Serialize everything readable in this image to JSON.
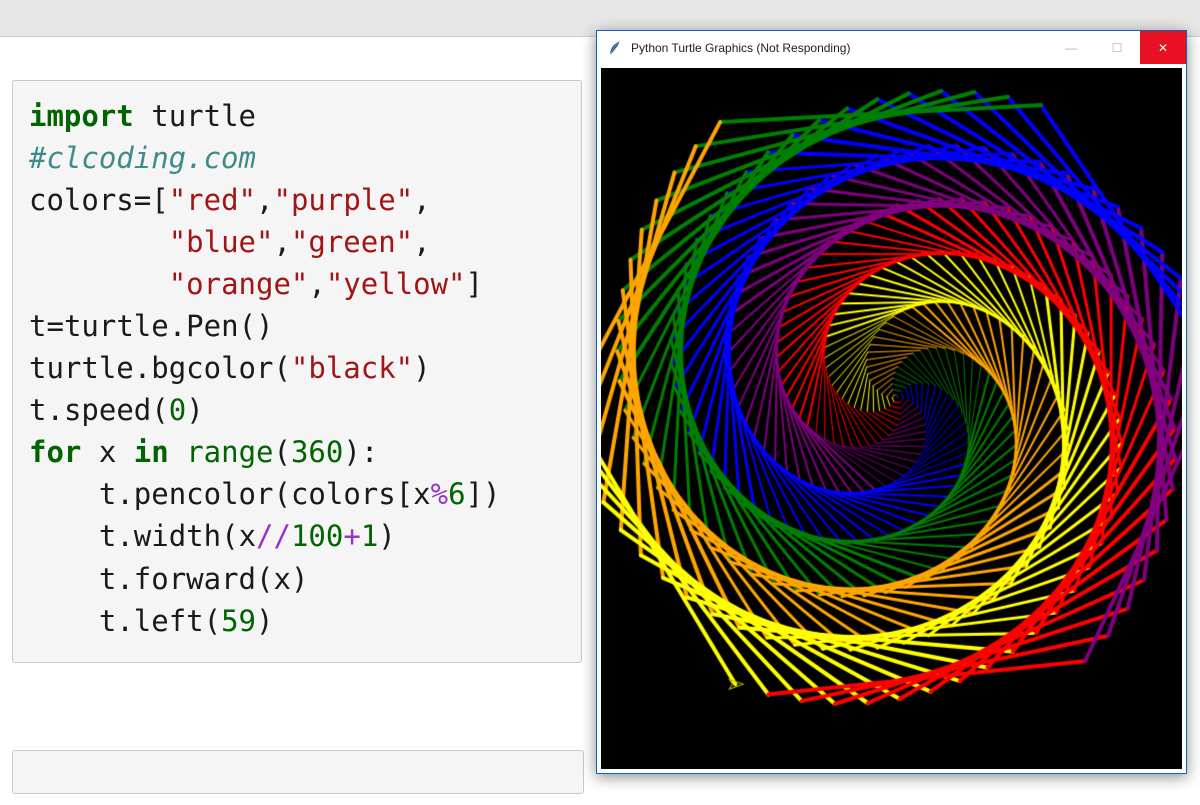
{
  "colors": [
    "red",
    "purple",
    "blue",
    "green",
    "orange",
    "yellow"
  ],
  "codeTokens": [
    [
      {
        "t": "import",
        "c": "kw"
      },
      {
        "t": " ",
        "c": "ident"
      },
      {
        "t": "turtle",
        "c": "ident"
      }
    ],
    [
      {
        "t": "#clcoding.com",
        "c": "cm"
      }
    ],
    [
      {
        "t": "colors",
        "c": "ident"
      },
      {
        "t": "=",
        "c": "punct"
      },
      {
        "t": "[",
        "c": "punct"
      },
      {
        "t": "\"red\"",
        "c": "str"
      },
      {
        "t": ",",
        "c": "punct"
      },
      {
        "t": "\"purple\"",
        "c": "str"
      },
      {
        "t": ",",
        "c": "punct"
      }
    ],
    [
      {
        "t": "        ",
        "c": "ident"
      },
      {
        "t": "\"blue\"",
        "c": "str"
      },
      {
        "t": ",",
        "c": "punct"
      },
      {
        "t": "\"green\"",
        "c": "str"
      },
      {
        "t": ",",
        "c": "punct"
      }
    ],
    [
      {
        "t": "        ",
        "c": "ident"
      },
      {
        "t": "\"orange\"",
        "c": "str"
      },
      {
        "t": ",",
        "c": "punct"
      },
      {
        "t": "\"yellow\"",
        "c": "str"
      },
      {
        "t": "]",
        "c": "punct"
      }
    ],
    [
      {
        "t": "t",
        "c": "ident"
      },
      {
        "t": "=",
        "c": "punct"
      },
      {
        "t": "turtle",
        "c": "ident"
      },
      {
        "t": ".",
        "c": "punct"
      },
      {
        "t": "Pen",
        "c": "ident"
      },
      {
        "t": "()",
        "c": "punct"
      }
    ],
    [
      {
        "t": "turtle",
        "c": "ident"
      },
      {
        "t": ".",
        "c": "punct"
      },
      {
        "t": "bgcolor",
        "c": "ident"
      },
      {
        "t": "(",
        "c": "punct"
      },
      {
        "t": "\"black\"",
        "c": "str"
      },
      {
        "t": ")",
        "c": "punct"
      }
    ],
    [
      {
        "t": "t",
        "c": "ident"
      },
      {
        "t": ".",
        "c": "punct"
      },
      {
        "t": "speed",
        "c": "ident"
      },
      {
        "t": "(",
        "c": "punct"
      },
      {
        "t": "0",
        "c": "num"
      },
      {
        "t": ")",
        "c": "punct"
      }
    ],
    [
      {
        "t": "for",
        "c": "kw"
      },
      {
        "t": " ",
        "c": "ident"
      },
      {
        "t": "x",
        "c": "ident"
      },
      {
        "t": " ",
        "c": "ident"
      },
      {
        "t": "in",
        "c": "kw"
      },
      {
        "t": " ",
        "c": "ident"
      },
      {
        "t": "range",
        "c": "builtin"
      },
      {
        "t": "(",
        "c": "punct"
      },
      {
        "t": "360",
        "c": "num"
      },
      {
        "t": "):",
        "c": "punct"
      }
    ],
    [
      {
        "t": "    ",
        "c": "ident"
      },
      {
        "t": "t",
        "c": "ident"
      },
      {
        "t": ".",
        "c": "punct"
      },
      {
        "t": "pencolor",
        "c": "ident"
      },
      {
        "t": "(",
        "c": "punct"
      },
      {
        "t": "colors",
        "c": "ident"
      },
      {
        "t": "[",
        "c": "punct"
      },
      {
        "t": "x",
        "c": "ident"
      },
      {
        "t": "%",
        "c": "op"
      },
      {
        "t": "6",
        "c": "num"
      },
      {
        "t": "])",
        "c": "punct"
      }
    ],
    [
      {
        "t": "    ",
        "c": "ident"
      },
      {
        "t": "t",
        "c": "ident"
      },
      {
        "t": ".",
        "c": "punct"
      },
      {
        "t": "width",
        "c": "ident"
      },
      {
        "t": "(",
        "c": "punct"
      },
      {
        "t": "x",
        "c": "ident"
      },
      {
        "t": "//",
        "c": "op"
      },
      {
        "t": "100",
        "c": "num"
      },
      {
        "t": "+",
        "c": "op"
      },
      {
        "t": "1",
        "c": "num"
      },
      {
        "t": ")",
        "c": "punct"
      }
    ],
    [
      {
        "t": "    ",
        "c": "ident"
      },
      {
        "t": "t",
        "c": "ident"
      },
      {
        "t": ".",
        "c": "punct"
      },
      {
        "t": "forward",
        "c": "ident"
      },
      {
        "t": "(",
        "c": "punct"
      },
      {
        "t": "x",
        "c": "ident"
      },
      {
        "t": ")",
        "c": "punct"
      }
    ],
    [
      {
        "t": "    ",
        "c": "ident"
      },
      {
        "t": "t",
        "c": "ident"
      },
      {
        "t": ".",
        "c": "punct"
      },
      {
        "t": "left",
        "c": "ident"
      },
      {
        "t": "(",
        "c": "punct"
      },
      {
        "t": "59",
        "c": "num"
      },
      {
        "t": ")",
        "c": "punct"
      }
    ]
  ],
  "turtleWindow": {
    "title": "Python Turtle Graphics (Not Responding)",
    "minimizeGlyph": "—",
    "maximizeGlyph": "☐",
    "closeGlyph": "✕",
    "bgcolor": "black",
    "iterations": 360,
    "angle": 59,
    "widthDivisor": 100
  }
}
